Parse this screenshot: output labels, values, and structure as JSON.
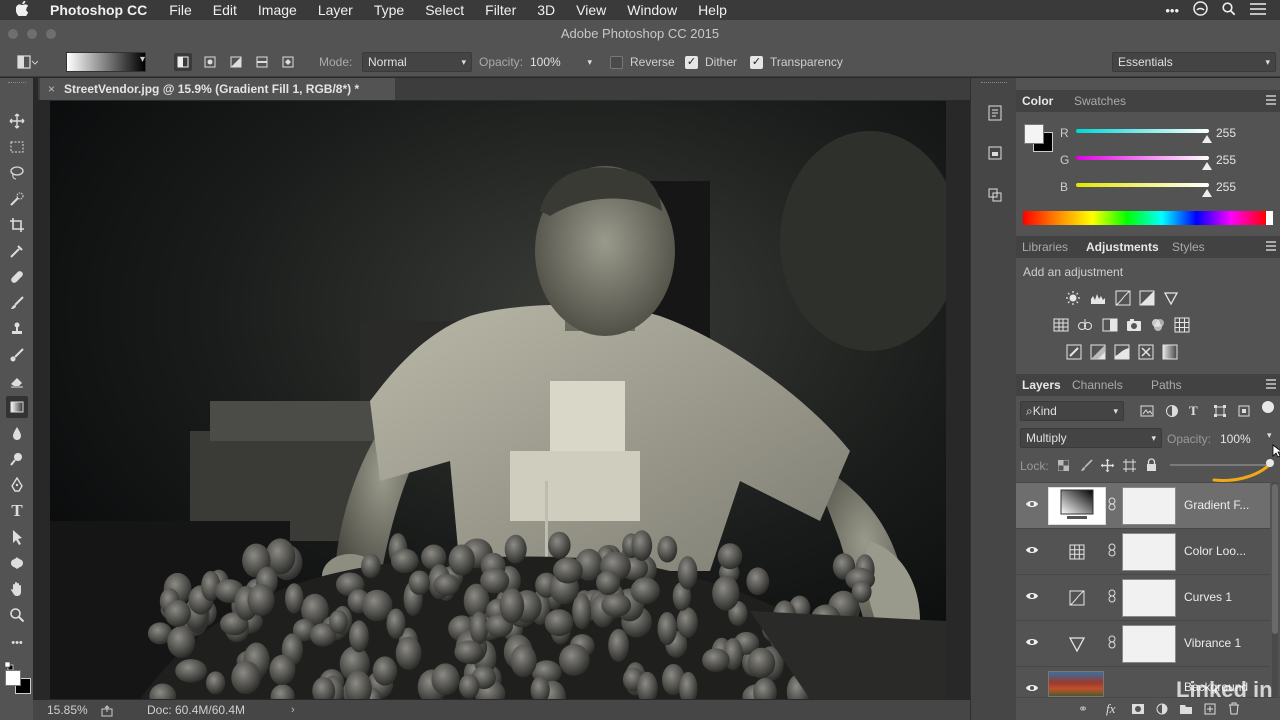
{
  "menubar": {
    "app_name": "Photoshop CC",
    "items": [
      "File",
      "Edit",
      "Image",
      "Layer",
      "Type",
      "Select",
      "Filter",
      "3D",
      "View",
      "Window",
      "Help"
    ]
  },
  "window": {
    "title": "Adobe Photoshop CC 2015"
  },
  "options": {
    "mode_label": "Mode:",
    "mode_value": "Normal",
    "opacity_label": "Opacity:",
    "opacity_value": "100%",
    "reverse_label": "Reverse",
    "reverse_checked": false,
    "dither_label": "Dither",
    "dither_checked": true,
    "transparency_label": "Transparency",
    "transparency_checked": true,
    "workspace": "Essentials"
  },
  "document": {
    "tab_title": "StreetVendor.jpg @ 15.9% (Gradient Fill 1, RGB/8*) *",
    "close_glyph": "×"
  },
  "status": {
    "zoom": "15.85%",
    "doc_info": "Doc: 60.4M/60.4M"
  },
  "color_panel": {
    "tabs": [
      "Color",
      "Swatches"
    ],
    "active_tab": "Color",
    "channels": [
      {
        "label": "R",
        "value": "255",
        "color": "#00d6d6"
      },
      {
        "label": "G",
        "value": "255",
        "color": "#e000e0"
      },
      {
        "label": "B",
        "value": "255",
        "color": "#e6e600"
      }
    ]
  },
  "adjustments_panel": {
    "tabs": [
      "Libraries",
      "Adjustments",
      "Styles"
    ],
    "active_tab": "Adjustments",
    "heading": "Add an adjustment",
    "icons": [
      [
        "brightness-contrast-icon",
        "levels-icon",
        "curves-icon",
        "exposure-icon",
        "vibrance-icon"
      ],
      [
        "hue-saturation-icon",
        "color-balance-icon",
        "black-white-icon",
        "photo-filter-icon",
        "channel-mixer-icon",
        "color-lookup-icon"
      ],
      [
        "invert-icon",
        "posterize-icon",
        "threshold-icon",
        "selective-color-icon",
        "gradient-map-icon"
      ]
    ]
  },
  "layers_panel": {
    "tabs": [
      "Layers",
      "Channels",
      "Paths"
    ],
    "active_tab": "Layers",
    "filter_kind": "Kind",
    "blend_mode": "Multiply",
    "opacity_label": "Opacity:",
    "opacity_value": "100%",
    "lock_label": "Lock:",
    "layers": [
      {
        "name": "Gradient F...",
        "type": "gradient-fill",
        "selected": true
      },
      {
        "name": "Color Loo...",
        "type": "color-lookup",
        "selected": false
      },
      {
        "name": "Curves 1",
        "type": "curves",
        "selected": false
      },
      {
        "name": "Vibrance 1",
        "type": "vibrance",
        "selected": false
      },
      {
        "name": "Background",
        "type": "background",
        "selected": false
      }
    ]
  },
  "watermark": "Linked in"
}
